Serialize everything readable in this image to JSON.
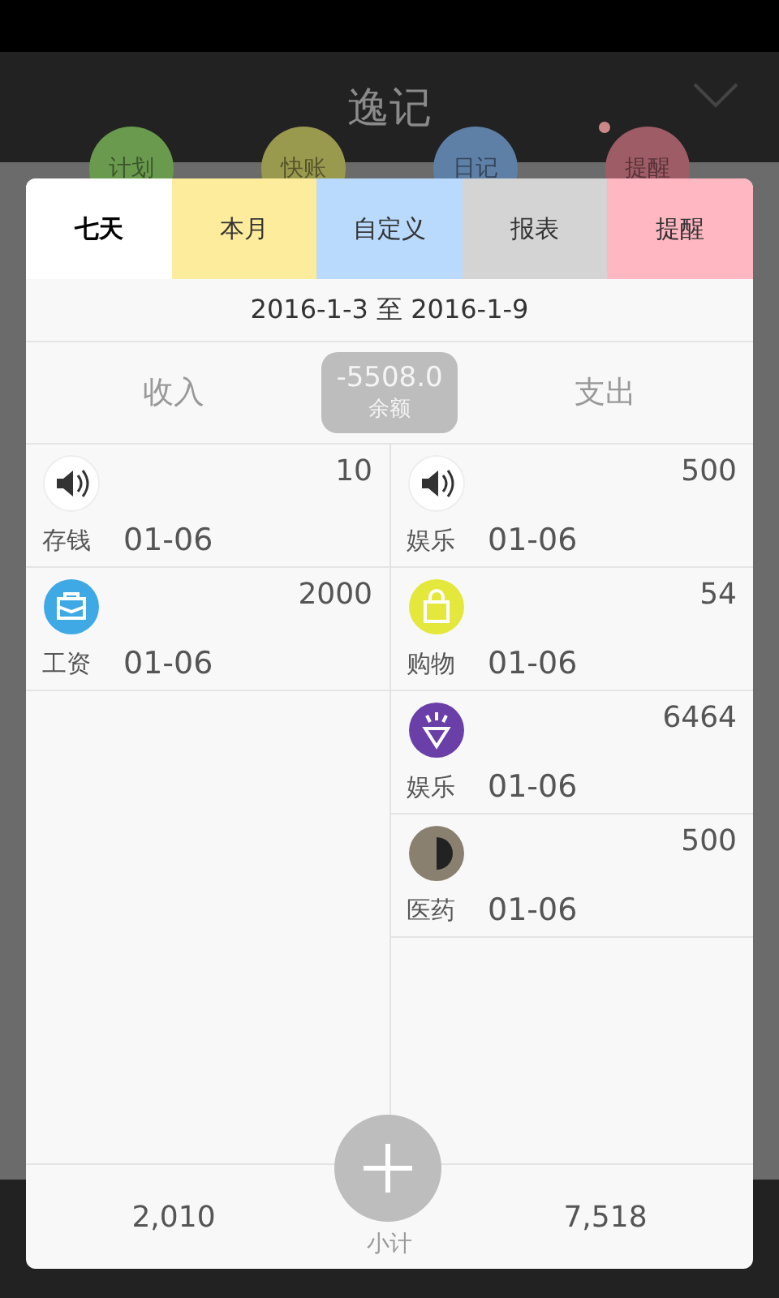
{
  "app": {
    "title": "逸记"
  },
  "nav": [
    {
      "label": "计划",
      "color": "#6a9a4e",
      "badge": false
    },
    {
      "label": "快账",
      "color": "#9a9a4e",
      "badge": false
    },
    {
      "label": "日记",
      "color": "#5e7fa6",
      "badge": false
    },
    {
      "label": "提醒",
      "color": "#9e5c66",
      "badge": true
    }
  ],
  "tabs": [
    {
      "label": "七天",
      "color": "#ffffff",
      "selected": true
    },
    {
      "label": "本月",
      "color": "#fdec9c",
      "selected": false
    },
    {
      "label": "自定义",
      "color": "#b9dafd",
      "selected": false
    },
    {
      "label": "报表",
      "color": "#d4d4d4",
      "selected": false
    },
    {
      "label": "提醒",
      "color": "#ffb7c2",
      "selected": false
    }
  ],
  "date_range": "2016-1-3 至 2016-1-9",
  "summary": {
    "income_label": "收入",
    "balance": "-5508.0",
    "balance_label": "余额",
    "expense_label": "支出"
  },
  "income": [
    {
      "kind": "speaker",
      "category": "存钱",
      "date": "01-06",
      "amount": "10"
    },
    {
      "kind": "briefcase",
      "category": "工资",
      "date": "01-06",
      "amount": "2000"
    }
  ],
  "expense": [
    {
      "kind": "speaker",
      "category": "娱乐",
      "date": "01-06",
      "amount": "500"
    },
    {
      "kind": "bag",
      "category": "购物",
      "date": "01-06",
      "amount": "54"
    },
    {
      "kind": "party",
      "category": "娱乐",
      "date": "01-06",
      "amount": "6464"
    },
    {
      "kind": "photo",
      "category": "医药",
      "date": "01-06",
      "amount": "500"
    }
  ],
  "footer": {
    "income_total": "2,010",
    "subtotal_label": "小计",
    "expense_total": "7,518"
  }
}
